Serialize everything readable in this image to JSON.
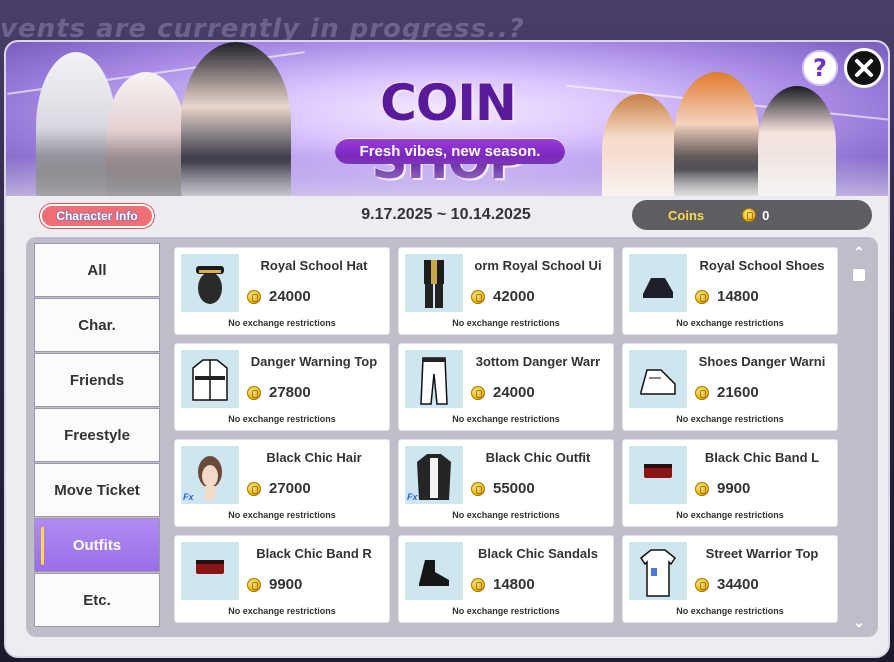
{
  "background": {
    "text": "vents are currently in progress..?"
  },
  "banner": {
    "title": "COIN SHOP",
    "subtitle": "Fresh vibes, new season."
  },
  "header": {
    "help_label": "?",
    "character_info_label": "Character Info",
    "date_range": "9.17.2025 ~ 10.14.2025",
    "coins_label": "Coins",
    "coins_value": "0"
  },
  "sidebar": {
    "items": [
      {
        "label": "All",
        "active": false
      },
      {
        "label": "Char.",
        "active": false
      },
      {
        "label": "Friends",
        "active": false
      },
      {
        "label": "Freestyle",
        "active": false
      },
      {
        "label": "Move Ticket",
        "active": false
      },
      {
        "label": "Outfits",
        "active": true
      },
      {
        "label": "Etc.",
        "active": false
      }
    ]
  },
  "items": [
    {
      "name": "Royal School Hat",
      "price": "24000",
      "note": "No exchange restrictions",
      "icon": "hat-icon",
      "fx": false
    },
    {
      "name": "orm   Royal School Ui",
      "price": "42000",
      "note": "No exchange restrictions",
      "icon": "uniform-icon",
      "fx": false
    },
    {
      "name": "Royal School Shoes",
      "price": "14800",
      "note": "No exchange restrictions",
      "icon": "shoes-icon",
      "fx": false
    },
    {
      "name": "Danger Warning Top",
      "price": "27800",
      "note": "No exchange restrictions",
      "icon": "jacket-icon",
      "fx": false
    },
    {
      "name": "3ottom   Danger Warr",
      "price": "24000",
      "note": "No exchange restrictions",
      "icon": "pants-icon",
      "fx": false
    },
    {
      "name": "Shoes   Danger Warni",
      "price": "21600",
      "note": "No exchange restrictions",
      "icon": "sneaker-icon",
      "fx": false
    },
    {
      "name": "Black Chic Hair",
      "price": "27000",
      "note": "No exchange restrictions",
      "icon": "hair-icon",
      "fx": true
    },
    {
      "name": "Black Chic Outfit",
      "price": "55000",
      "note": "No exchange restrictions",
      "icon": "outfit-icon",
      "fx": true
    },
    {
      "name": "Black Chic Band L",
      "price": "9900",
      "note": "No exchange restrictions",
      "icon": "band-icon",
      "fx": false
    },
    {
      "name": "Black Chic Band R",
      "price": "9900",
      "note": "No exchange restrictions",
      "icon": "band-icon",
      "fx": false
    },
    {
      "name": "Black Chic Sandals",
      "price": "14800",
      "note": "No exchange restrictions",
      "icon": "sandal-icon",
      "fx": false
    },
    {
      "name": "Street Warrior Top",
      "price": "34400",
      "note": "No exchange restrictions",
      "icon": "shirt-icon",
      "fx": false
    }
  ],
  "fx_label": "Fx",
  "colors": {
    "accent": "#9a6ee8",
    "title": "#5a1a9c",
    "coin": "#f2c21a",
    "thumb_bg": "#cfe6ee"
  }
}
